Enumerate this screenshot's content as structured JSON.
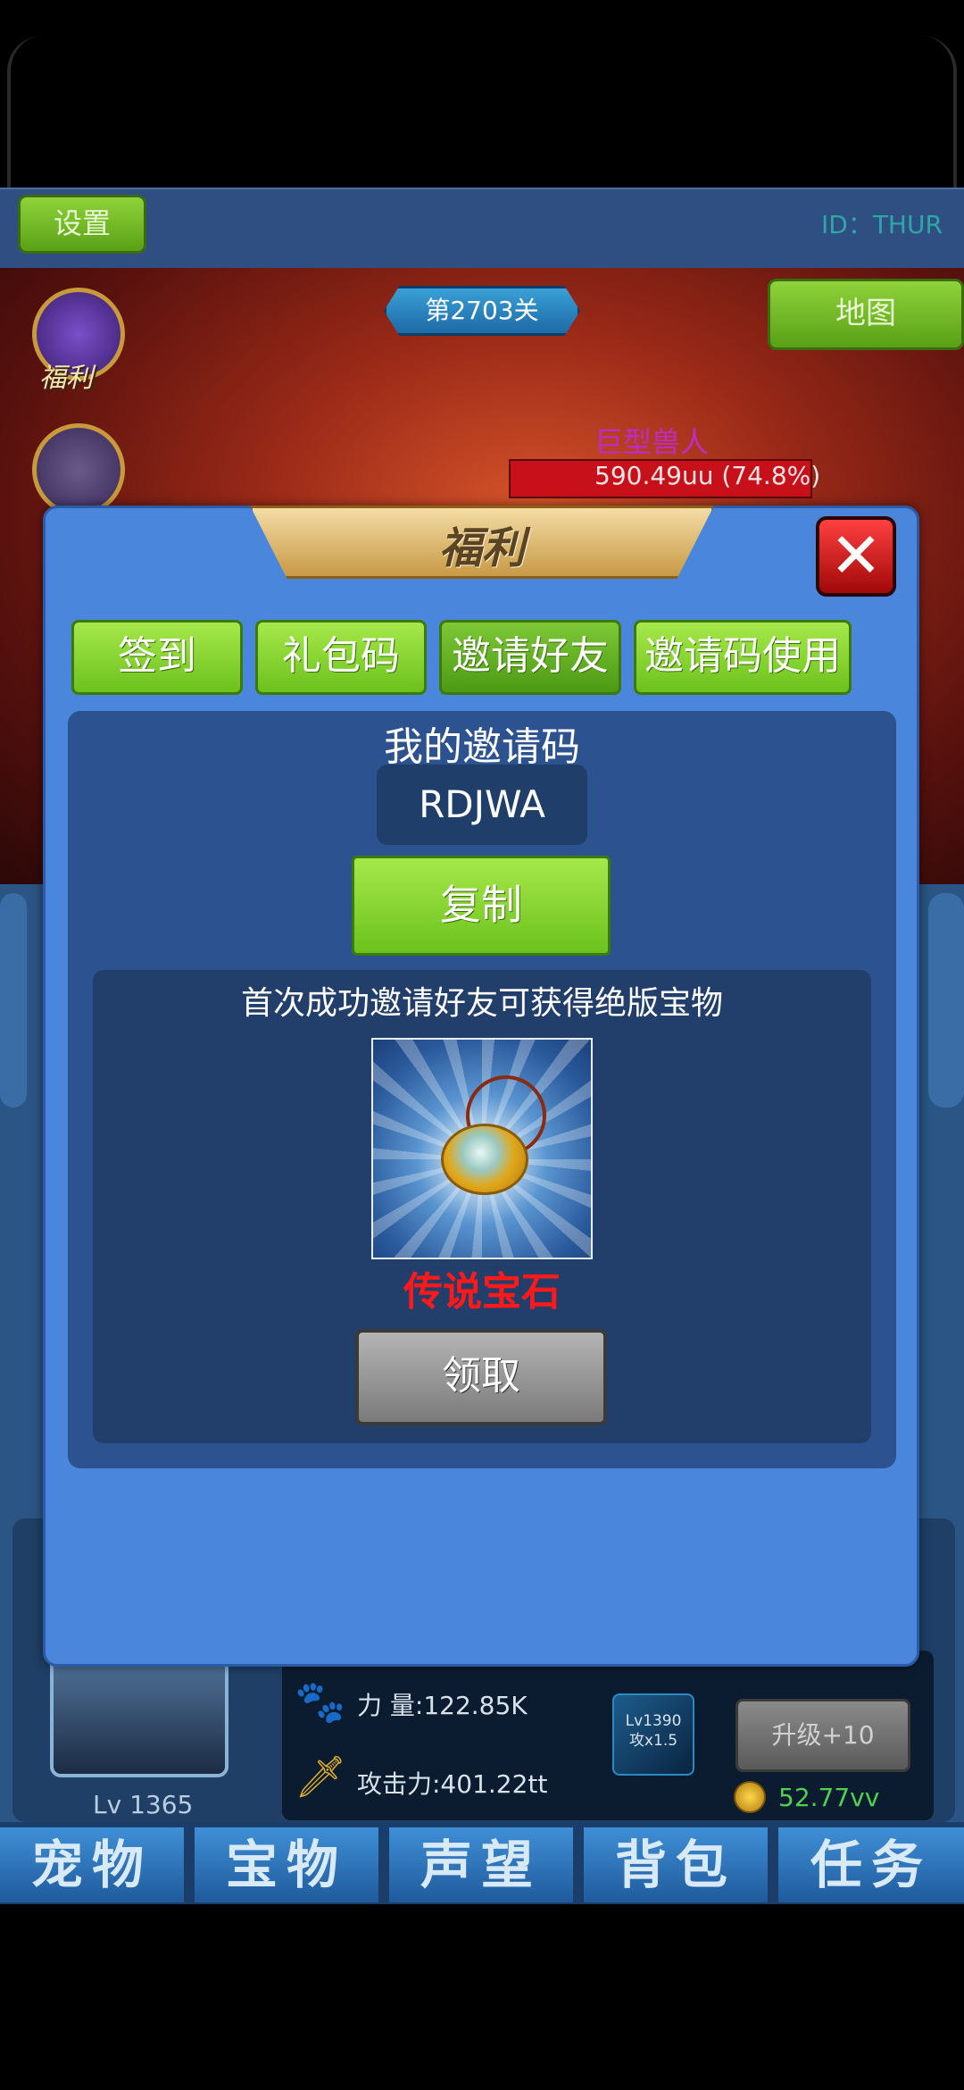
{
  "top_bar": {
    "settings_label": "设置",
    "user_id": "ID：THUR"
  },
  "scene": {
    "stage_label": "第2703关",
    "map_label": "地图",
    "welfare_label": "福利",
    "enemy_name": "巨型兽人",
    "enemy_hp_text": "590.49uu (74.8%)",
    "enemy_hp_percent": 74.8
  },
  "modal": {
    "title": "福利",
    "close_symbol": "✕",
    "tabs": [
      {
        "label": "签到"
      },
      {
        "label": "礼包码"
      },
      {
        "label": "邀请好友",
        "active": true
      },
      {
        "label": "邀请码使用"
      }
    ],
    "my_code_label": "我的邀请码",
    "invite_code": "RDJWA",
    "copy_label": "复制",
    "reward_description": "首次成功邀请好友可获得绝版宝物",
    "reward_item_name": "传说宝石",
    "claim_label": "领取"
  },
  "hero": {
    "level": "Lv 1365",
    "power": "力  量:122.85K",
    "attack": "攻击力:401.22tt",
    "skill_level": "Lv1390",
    "skill_bonus": "攻x1.5",
    "upgrade_label": "升级+10",
    "coins": "52.77vv"
  },
  "bottom_nav": [
    "宠物",
    "宝物",
    "声望",
    "背包",
    "任务"
  ],
  "colors": {
    "accent_green": "#6cc21c",
    "modal_blue": "#4a86dc",
    "reward_red": "#ff1a1a"
  }
}
